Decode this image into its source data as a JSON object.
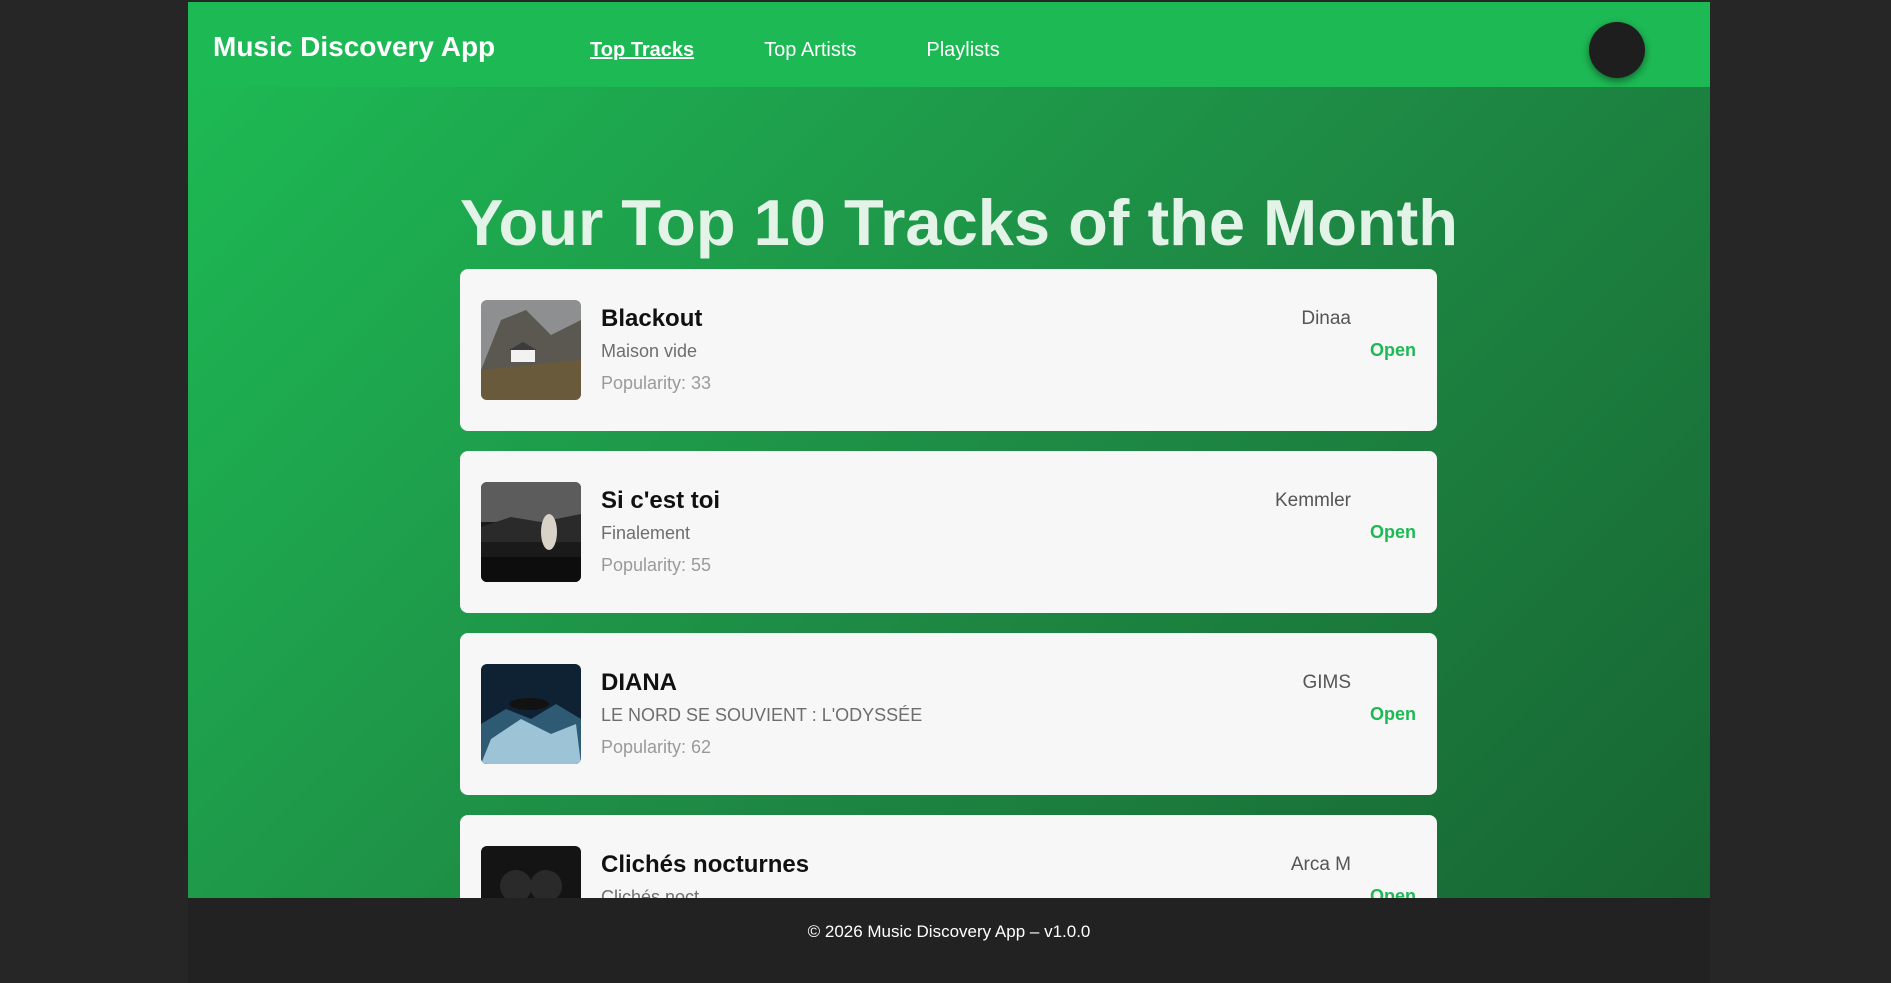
{
  "app": {
    "title": "Music Discovery App"
  },
  "nav": [
    {
      "label": "Top Tracks",
      "active": true
    },
    {
      "label": "Top Artists",
      "active": false
    },
    {
      "label": "Playlists",
      "active": false
    }
  ],
  "avatar": {
    "icon": "user-avatar"
  },
  "main": {
    "heading": "Your Top 10 Tracks of the Month"
  },
  "tracks": [
    {
      "title": "Blackout",
      "album": "Maison vide",
      "popularity": "Popularity: 33",
      "artist": "Dinaa",
      "action": "Open",
      "cover_icon": "album-cover"
    },
    {
      "title": "Si c'est toi",
      "album": "Finalement",
      "popularity": "Popularity: 55",
      "artist": "Kemmler",
      "action": "Open",
      "cover_icon": "album-cover"
    },
    {
      "title": "DIANA",
      "album": "LE NORD SE SOUVIENT : L'ODYSSÉE",
      "popularity": "Popularity: 62",
      "artist": "GIMS",
      "action": "Open",
      "cover_icon": "album-cover"
    },
    {
      "title": "Clichés nocturnes",
      "album": "Clichés noct",
      "popularity": "",
      "artist": "Arca M",
      "action": "Open",
      "cover_icon": "album-cover"
    }
  ],
  "footer": {
    "text": "© 2026 Music Discovery App – v1.0.0"
  },
  "colors": {
    "accent": "#1db954",
    "background": "#262626",
    "card": "#f7f7f7"
  }
}
